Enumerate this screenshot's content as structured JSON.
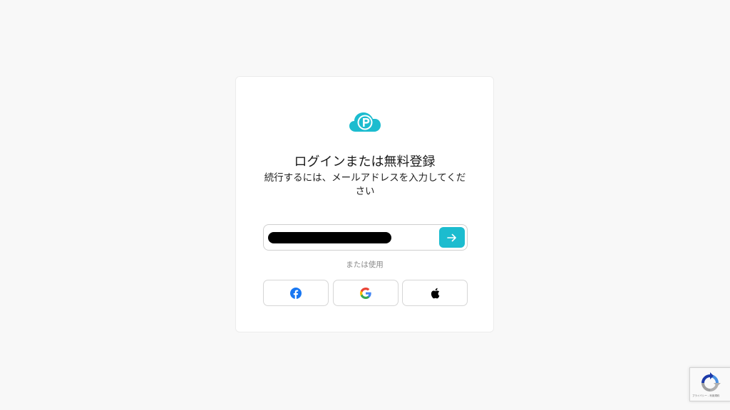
{
  "login": {
    "title": "ログインまたは無料登録",
    "subtitle": "続行するには、メールアドレスを入力してください",
    "email_value": "",
    "or_text": "または使用"
  },
  "social": {
    "facebook": "facebook-icon",
    "google": "google-icon",
    "apple": "apple-icon"
  },
  "recaptcha": {
    "footer_text": "プライバシー - 利用規約"
  },
  "colors": {
    "accent": "#1cbccf",
    "facebook": "#1877f2",
    "background": "#f8f8f8"
  }
}
